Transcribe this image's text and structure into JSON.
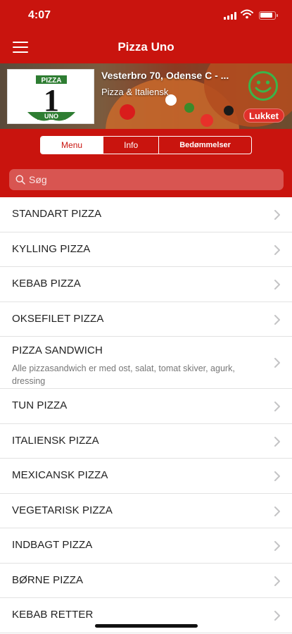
{
  "status_bar": {
    "time": "4:07"
  },
  "nav": {
    "title": "Pizza Uno"
  },
  "restaurant": {
    "logo_text_top": "PIZZA",
    "logo_text_number": "1",
    "logo_text_bottom": "UNO",
    "address": "Vesterbro 70, Odense C - ...",
    "cuisine": "Pizza & Italiensk",
    "status": "Lukket"
  },
  "tabs": [
    {
      "label": "Menu",
      "active": true
    },
    {
      "label": "Info",
      "active": false
    },
    {
      "label": "Bedømmelser",
      "active": false
    }
  ],
  "search": {
    "placeholder": "Søg",
    "value": ""
  },
  "categories": [
    {
      "title": "STANDART PIZZA"
    },
    {
      "title": "KYLLING PIZZA"
    },
    {
      "title": "KEBAB PIZZA"
    },
    {
      "title": "OKSEFILET PIZZA"
    },
    {
      "title": "PIZZA SANDWICH",
      "description": "Alle pizzasandwich er med ost, salat, tomat skiver, agurk, dressing"
    },
    {
      "title": "TUN PIZZA"
    },
    {
      "title": "ITALIENSK PIZZA"
    },
    {
      "title": "MEXICANSK PIZZA"
    },
    {
      "title": "VEGETARISK PIZZA"
    },
    {
      "title": "INDBAGT PIZZA"
    },
    {
      "title": "BØRNE PIZZA"
    },
    {
      "title": "KEBAB RETTER"
    }
  ],
  "colors": {
    "brand_red": "#c9140e",
    "smiley_green": "#3ab54a",
    "badge_red": "#e0302a"
  },
  "icons": {
    "menu": "hamburger-icon",
    "search": "search-icon",
    "rating": "smiley-icon",
    "chevron": "chevron-right-icon"
  }
}
